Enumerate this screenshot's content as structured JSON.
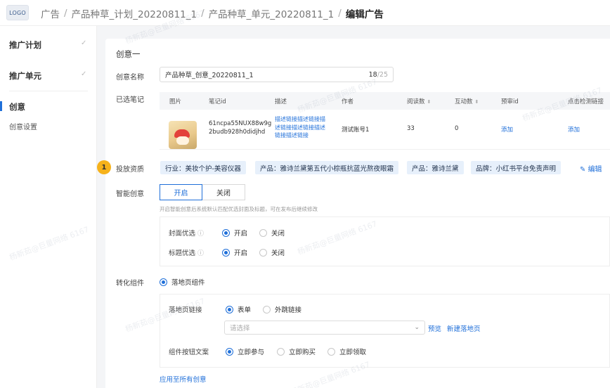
{
  "header": {
    "logo": "LOGO",
    "breadcrumbs": [
      "广告",
      "产品种草_计划_20220811_1",
      "产品种草_单元_20220811_1"
    ],
    "current": "编辑广告"
  },
  "sidebar": {
    "items": [
      {
        "label": "推广计划"
      },
      {
        "label": "推广单元"
      },
      {
        "label": "创意"
      }
    ],
    "sub_items": [
      {
        "label": "创意设置"
      }
    ],
    "check_icon": "check-icon"
  },
  "creative": {
    "section_title": "创意一",
    "name_label": "创意名称",
    "name_value": "产品种草_创意_20220811_1",
    "name_count": "18",
    "name_max": "/25",
    "notes_label": "已选笔记",
    "table": {
      "headers": [
        "图片",
        "笔记id",
        "描述",
        "作者",
        "阅读数",
        "互动数",
        "预审id",
        "点击检测链接"
      ],
      "rows": [
        {
          "note_id": [
            "61ncpa55NUX88w9g",
            "2budb928h0didjhd"
          ],
          "desc": [
            "描述链接描述链接描",
            "述链接描述链接描述",
            "链接描述链接"
          ],
          "author": "测试账号1",
          "reads": "33",
          "interactions": "0",
          "review_id": "添加",
          "click_link": "添加"
        }
      ]
    },
    "delivery": {
      "step_number": "1",
      "label": "投放资质",
      "tags": [
        "行业：美妆个护-美容仪器",
        "产品：雅诗兰黛第五代小棕瓶抗蓝光熬夜眼霜",
        "产品：雅诗兰黛",
        "品牌：小红书平台免责声明"
      ],
      "edit": "编辑"
    },
    "smart": {
      "label": "智能创意",
      "options": [
        "开启",
        "关闭"
      ],
      "selected": "开启",
      "hint": "开启智能创意后系统默认匹配优选封面及标题，可在发布后继续修改",
      "cover_label": "封面优选",
      "title_label": "标题优选",
      "on": "开启",
      "off": "关闭"
    },
    "component": {
      "label": "转化组件",
      "type": "落地页组件",
      "landing_label": "落地页链接",
      "landing_options": [
        "表单",
        "外跳链接"
      ],
      "select_placeholder": "请选择",
      "preview": "预览",
      "new_page": "新建落地页",
      "button_label": "组件按钮文案",
      "button_options": [
        "立即参与",
        "立即购买",
        "立即领取"
      ],
      "apply_all": "应用至所有创意"
    }
  },
  "watermark": "杨新茹@巨量网络 6167",
  "colors": {
    "accent": "#1f6fd9",
    "badge": "#f6b21b",
    "tag_bg": "#e7f0fb"
  }
}
